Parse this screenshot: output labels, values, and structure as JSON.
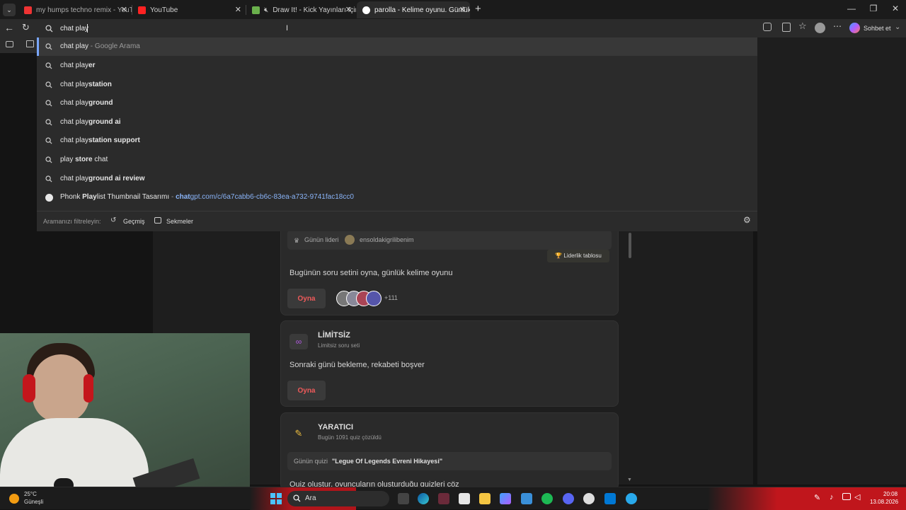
{
  "browser": {
    "tabs": [
      {
        "label": "my humps techno remix - YouTub",
        "close": "✕"
      },
      {
        "label": "YouTube",
        "close": "✕"
      },
      {
        "label": "Draw It! - Kick Yayınları İçin Ç",
        "close": "✕"
      },
      {
        "label": "parolla - Kelime oyunu. Günlük ke",
        "close": "✕"
      }
    ],
    "new_tab": "+",
    "window": {
      "minimize": "—",
      "restore": "❐",
      "close": "✕"
    }
  },
  "omnibox": {
    "value": "chat play",
    "chat_label": "Sohbet et"
  },
  "suggestions": [
    {
      "prefix": "chat play",
      "bold": "",
      "suffix": " - Google Arama"
    },
    {
      "prefix": "chat play",
      "bold": "er",
      "suffix": ""
    },
    {
      "prefix": "chat play",
      "bold": "station",
      "suffix": ""
    },
    {
      "prefix": "chat play",
      "bold": "ground",
      "suffix": ""
    },
    {
      "prefix": "chat play",
      "bold": "ground ai",
      "suffix": ""
    },
    {
      "prefix": "chat play",
      "bold": "station support",
      "suffix": ""
    },
    {
      "prefix": "play ",
      "bold": "store",
      "suffix": " chat"
    },
    {
      "prefix": "chat play",
      "bold": "ground ai review",
      "suffix": ""
    }
  ],
  "history_suggestion": {
    "title_pre": "Phonk ",
    "title_bold": "Play",
    "title_post": "list Thumbnail Tasarımı",
    "sep": " - ",
    "url_bold": "chat",
    "url_rest": "gpt.com/c/6a7cabb6-cb6c-83ea-a732-9741fac18cc0"
  },
  "filter": {
    "label": "Aramanızı filtreleyin:",
    "history": "Geçmiş",
    "tabs": "Sekmeler"
  },
  "page": {
    "daily": {
      "leader_label": "Günün lideri",
      "leader_name": "ensoldakigrilibenim",
      "leaderboard": "🏆 Liderlik tablosu",
      "desc": "Bugünün soru setini oyna, günlük kelime oyunu",
      "play": "Oyna",
      "players_more": "+111"
    },
    "unlimited": {
      "title": "LİMİTSİZ",
      "subtitle": "Limitsiz soru seti",
      "desc": "Sonraki günü bekleme, rekabeti boşver",
      "play": "Oyna"
    },
    "creator": {
      "title": "YARATICI",
      "subtitle": "Bugün 1091 quiz çözüldü",
      "quiz_label": "Günün quizi",
      "quiz_name": "\"Legue Of Legends Evreni Hikayesi\"",
      "desc_partial": "Quiz oluştur, oyuncuların oluşturduğu quizleri çöz"
    }
  },
  "taskbar": {
    "temp": "25°C",
    "weather": "Güneşli",
    "search": "Ara",
    "time": "20:08",
    "date": "13.08.2026"
  },
  "colors": {
    "accent_red": "#ef5a5a",
    "link": "#8ab4f8",
    "selected_bar": "#7aa7ff"
  }
}
